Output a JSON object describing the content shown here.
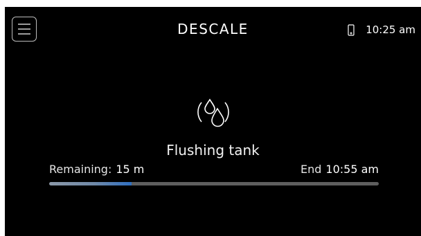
{
  "header": {
    "title": "DESCALE",
    "time": "10:25 am",
    "menu_icon": "hamburger-menu-icon",
    "device_icon": "phone-icon"
  },
  "main": {
    "icon": "water-drops-icon",
    "status": "Flushing tank",
    "remaining_label": "Remaining:",
    "remaining_value": "15 m",
    "end_label": "End",
    "end_value": "10:55 am",
    "progress_fraction": 0.25
  },
  "colors": {
    "background": "#000000",
    "text": "#ffffff",
    "progress_track": "#5e5e5e",
    "progress_fill": "#2f6fc1"
  }
}
